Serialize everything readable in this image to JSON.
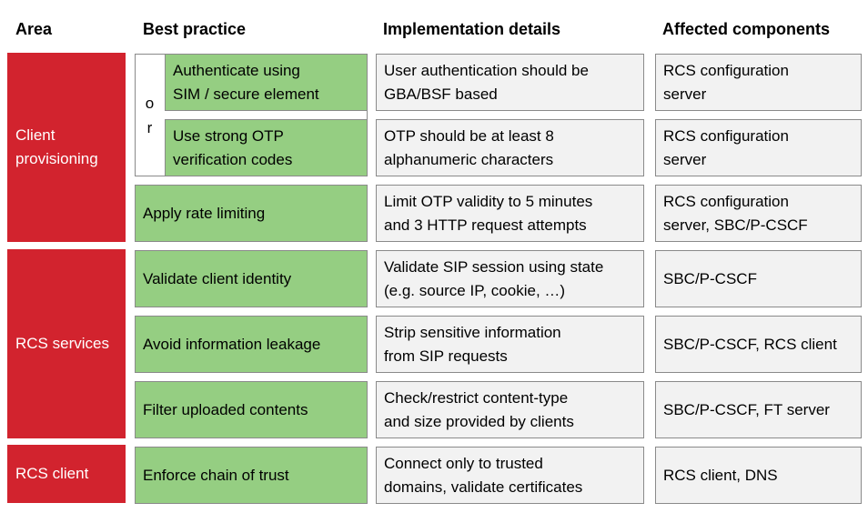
{
  "headers": {
    "area": "Area",
    "best_practice": "Best practice",
    "implementation": "Implementation details",
    "affected": "Affected components"
  },
  "colors": {
    "area_fill": "#D2232E",
    "practice_fill": "#95CE82",
    "detail_fill": "#F2F2F2",
    "border": "#8A8A8A"
  },
  "areas": [
    {
      "lines": [
        "Client",
        "provisioning"
      ]
    },
    {
      "lines": [
        "RCS services"
      ]
    },
    {
      "lines": [
        "RCS client"
      ]
    }
  ],
  "or_label": [
    "o",
    "r"
  ],
  "rows": [
    {
      "area": "Client provisioning",
      "practice": [
        "Authenticate using",
        "SIM / secure element"
      ],
      "implementation": [
        "User authentication should be",
        "GBA/BSF based"
      ],
      "affected": [
        "RCS configuration",
        "server"
      ]
    },
    {
      "area": "Client provisioning",
      "practice": [
        "Use strong OTP",
        "verification codes"
      ],
      "implementation": [
        "OTP should be at least 8",
        "alphanumeric characters"
      ],
      "affected": [
        "RCS configuration",
        "server"
      ]
    },
    {
      "area": "Client provisioning",
      "practice": [
        "Apply rate limiting"
      ],
      "implementation": [
        "Limit OTP validity to 5 minutes",
        "and 3 HTTP request attempts"
      ],
      "affected": [
        "RCS configuration",
        "server, SBC/P-CSCF"
      ]
    },
    {
      "area": "RCS services",
      "practice": [
        "Validate client identity"
      ],
      "implementation": [
        "Validate SIP session using state",
        "(e.g. source IP, cookie, …)"
      ],
      "affected": [
        "SBC/P-CSCF"
      ]
    },
    {
      "area": "RCS services",
      "practice": [
        "Avoid information leakage"
      ],
      "implementation": [
        "Strip sensitive information",
        "from SIP requests"
      ],
      "affected": [
        "SBC/P-CSCF, RCS client"
      ]
    },
    {
      "area": "RCS services",
      "practice": [
        "Filter uploaded contents"
      ],
      "implementation": [
        "Check/restrict content-type",
        "and size provided by clients"
      ],
      "affected": [
        "SBC/P-CSCF, FT server"
      ]
    },
    {
      "area": "RCS client",
      "practice": [
        "Enforce chain of trust"
      ],
      "implementation": [
        "Connect only to trusted",
        "domains, validate certificates"
      ],
      "affected": [
        "RCS client, DNS"
      ]
    }
  ]
}
